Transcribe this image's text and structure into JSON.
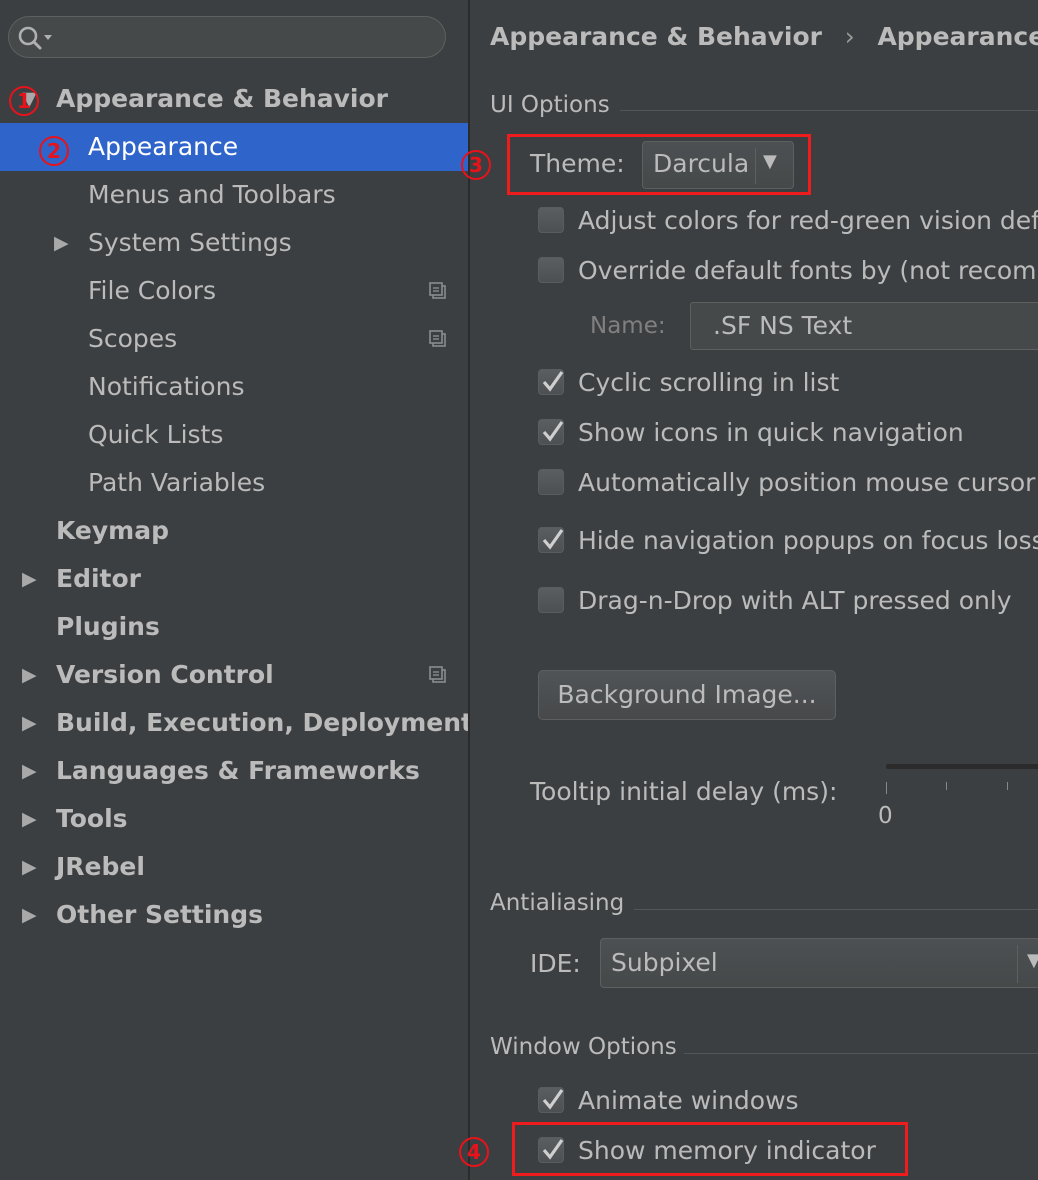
{
  "search": {
    "placeholder": ""
  },
  "sidebar": {
    "items": [
      {
        "label": "Appearance & Behavior"
      },
      {
        "label": "Appearance"
      },
      {
        "label": "Menus and Toolbars"
      },
      {
        "label": "System Settings"
      },
      {
        "label": "File Colors"
      },
      {
        "label": "Scopes"
      },
      {
        "label": "Notifications"
      },
      {
        "label": "Quick Lists"
      },
      {
        "label": "Path Variables"
      },
      {
        "label": "Keymap"
      },
      {
        "label": "Editor"
      },
      {
        "label": "Plugins"
      },
      {
        "label": "Version Control"
      },
      {
        "label": "Build, Execution, Deployment"
      },
      {
        "label": "Languages & Frameworks"
      },
      {
        "label": "Tools"
      },
      {
        "label": "JRebel"
      },
      {
        "label": "Other Settings"
      }
    ]
  },
  "markers": [
    "1",
    "2",
    "3",
    "4"
  ],
  "breadcrumb": {
    "parent": "Appearance & Behavior",
    "separator": "›",
    "current": "Appearance"
  },
  "ui_options": {
    "title": "UI Options",
    "theme_label": "Theme:",
    "theme_value": "Darcula",
    "options": [
      {
        "label": "Adjust colors for red-green vision def",
        "checked": false
      },
      {
        "label": "Override default fonts by (not recomm",
        "checked": false
      },
      {
        "label": "Cyclic scrolling in list",
        "checked": true
      },
      {
        "label": "Show icons in quick navigation",
        "checked": true
      },
      {
        "label": "Automatically position mouse cursor",
        "checked": false
      },
      {
        "label": "Hide navigation popups on focus loss",
        "checked": true
      },
      {
        "label": "Drag-n-Drop with ALT pressed only",
        "checked": false
      }
    ],
    "font_name_label": "Name:",
    "font_name_value": ".SF NS Text",
    "background_button": "Background Image...",
    "tooltip_label": "Tooltip initial delay (ms):",
    "tooltip_min": "0"
  },
  "antialiasing": {
    "title": "Antialiasing",
    "ide_label": "IDE:",
    "ide_value": "Subpixel"
  },
  "window_options": {
    "title": "Window Options",
    "options": [
      {
        "label": "Animate windows",
        "checked": true
      },
      {
        "label": "Show memory indicator",
        "checked": true
      }
    ]
  },
  "colors": {
    "background": "#3c3f41",
    "selection": "#2f65ca",
    "text": "#bbbbbb",
    "annotation_red": "#ee1c1c"
  }
}
